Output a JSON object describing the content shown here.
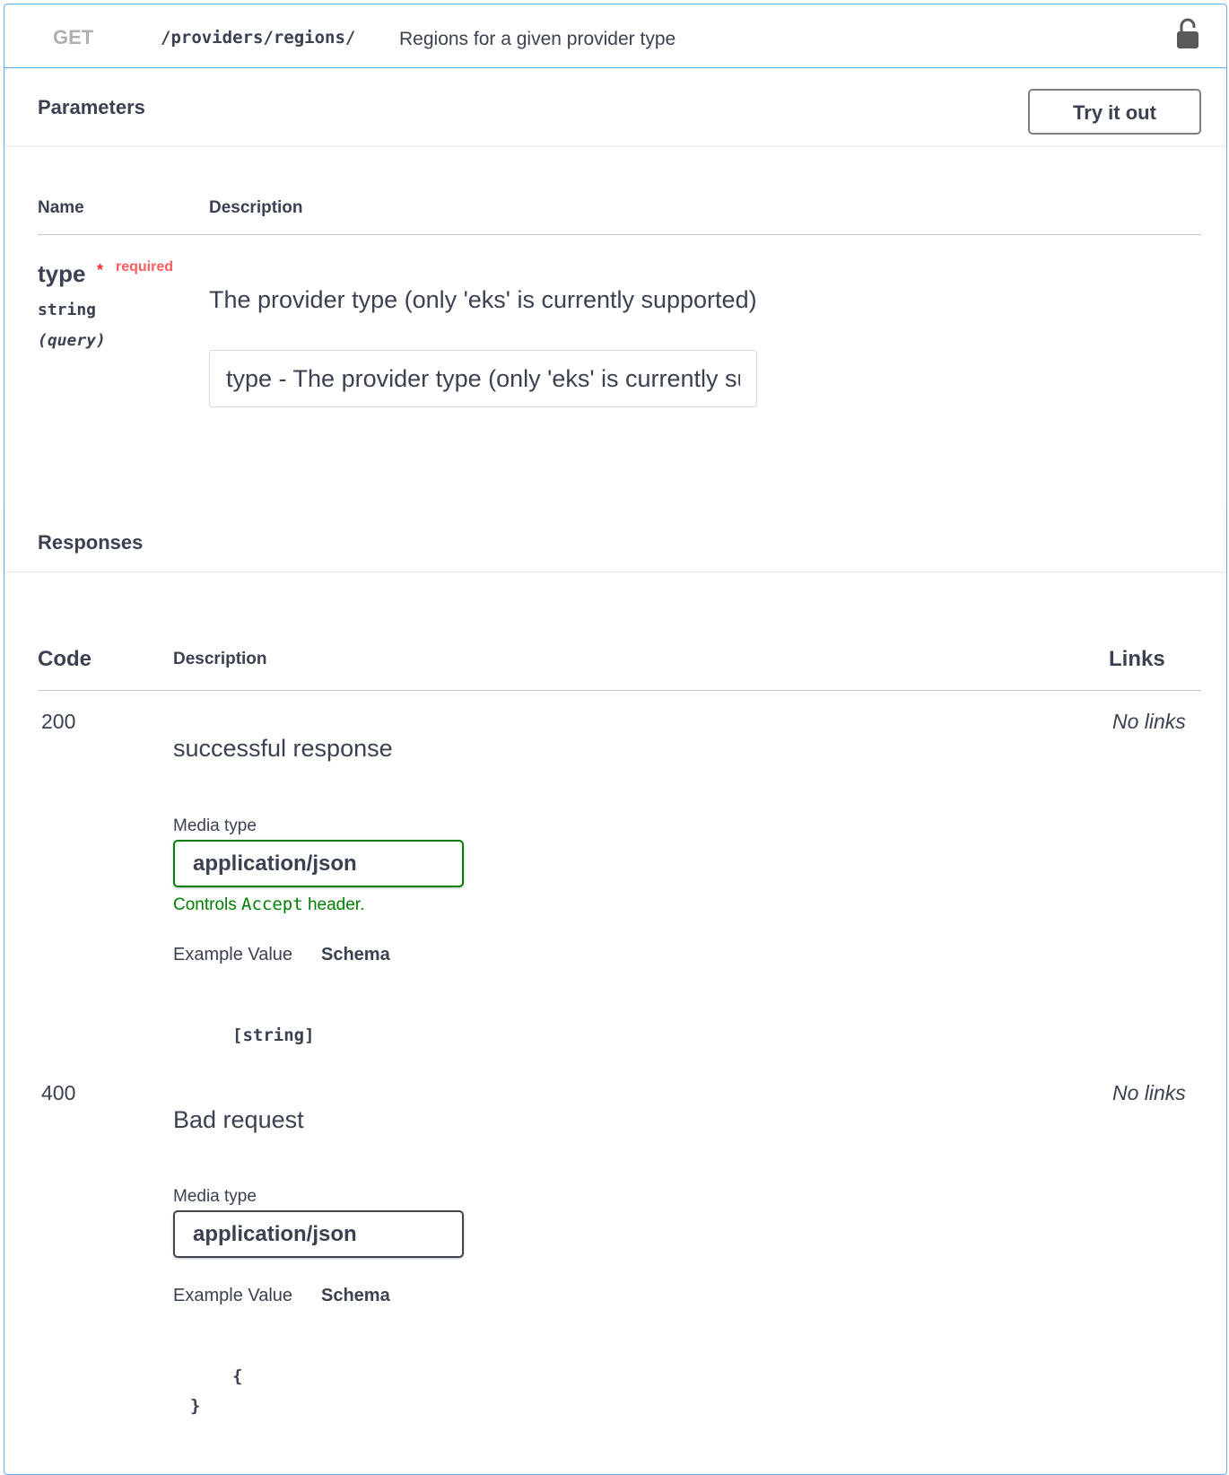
{
  "operation": {
    "method": "GET",
    "path": "/providers/regions/",
    "summary": "Regions for a given provider type",
    "lock_icon": "lock-open-icon"
  },
  "parameters": {
    "title": "Parameters",
    "try_label": "Try it out",
    "col_name": "Name",
    "col_description": "Description",
    "items": [
      {
        "name": "type",
        "required_star": "*",
        "required_label": "required",
        "type": "string",
        "in": "(query)",
        "description": "The provider type (only 'eks' is currently supported)",
        "placeholder": "type - The provider type (only 'eks' is currently supported)"
      }
    ]
  },
  "responses": {
    "title": "Responses",
    "col_code": "Code",
    "col_description": "Description",
    "col_links": "Links",
    "items": [
      {
        "code": "200",
        "description": "successful response",
        "links": "No links",
        "media_label": "Media type",
        "media_value": "application/json",
        "controls_pre": "Controls ",
        "controls_code": "Accept",
        "controls_post": " header.",
        "tab_example": "Example Value",
        "tab_schema": "Schema",
        "model": "[string]"
      },
      {
        "code": "400",
        "description": "Bad request",
        "links": "No links",
        "media_label": "Media type",
        "media_value": "application/json",
        "tab_example": "Example Value",
        "tab_schema": "Schema",
        "model_open": "{",
        "model_close": "}"
      }
    ]
  },
  "colors": {
    "border": "#61affe",
    "accent_green": "#008000",
    "required": "#ff2d2d"
  }
}
